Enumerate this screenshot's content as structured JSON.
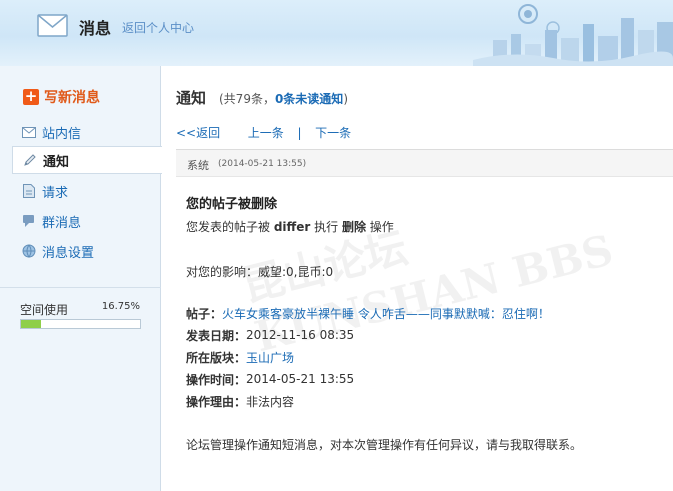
{
  "header": {
    "title": "消息",
    "back_link": "返回个人中心",
    "icon": "envelope-icon"
  },
  "sidebar": {
    "compose_label": "写新消息",
    "items": [
      {
        "label": "站内信",
        "icon": "envelope-icon"
      },
      {
        "label": "通知",
        "icon": "pencil-icon",
        "active": true
      },
      {
        "label": "请求",
        "icon": "document-icon"
      },
      {
        "label": "群消息",
        "icon": "chat-icon"
      },
      {
        "label": "消息设置",
        "icon": "globe-icon"
      }
    ],
    "space": {
      "label": "空间使用",
      "percent_text": "16.75%",
      "percent": 16.75
    }
  },
  "main": {
    "title": "通知",
    "stats": {
      "prefix": "(共79条，",
      "unread": "0条未读通知",
      "suffix": ")"
    },
    "nav": {
      "back": "<<返回",
      "prev": "上一条",
      "sep": "|",
      "next": "下一条"
    },
    "message": {
      "sender": "系统",
      "time": "(2014-05-21 13:55)",
      "title": "您的帖子被删除",
      "line1_a": "您发表的帖子被 ",
      "line1_user": "differ",
      "line1_b": " 执行 ",
      "line1_action": "删除",
      "line1_c": " 操作",
      "impact": "对您的影响：威望:0,昆币:0",
      "post_label": "帖子：",
      "post_title": "火车女乘客豪放半裸午睡 令人咋舌——同事默默喊：忍住啊！",
      "date_label": "发表日期：",
      "date_value": "2012-11-16 08:35",
      "forum_label": "所在版块：",
      "forum_value": "玉山广场",
      "op_time_label": "操作时间：",
      "op_time_value": "2014-05-21 13:55",
      "reason_label": "操作理由：",
      "reason_value": "非法内容",
      "footer": "论坛管理操作通知短消息，对本次管理操作有任何异议，请与我取得联系。"
    },
    "watermark": "昆山论坛 KUNSHAN BBS"
  },
  "colors": {
    "accent": "#1b6bb5",
    "compose": "#e05a1a",
    "sidebar_bg": "#eef5fb",
    "progress": "#8fcf4a"
  }
}
